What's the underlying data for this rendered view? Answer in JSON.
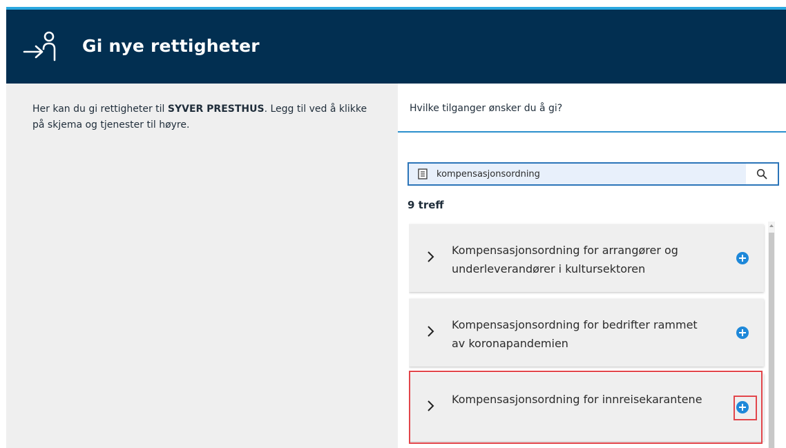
{
  "header": {
    "title": "Gi nye rettigheter",
    "icon": "person-arrow-icon"
  },
  "left": {
    "intro_before": "Her kan du gi rettigheter til ",
    "intro_name": "SYVER PRESTHUS",
    "intro_after": ". Legg til ved å klikke på skjema og tjenester til høyre."
  },
  "right": {
    "question": "Hvilke tilganger ønsker du å gi?",
    "search": {
      "value": "kompensasjonsordning",
      "icon": "document-icon",
      "button_icon": "search-icon"
    },
    "hits": "9 treff",
    "results": [
      {
        "title": "Kompensasjonsordning for arrangører og underleverandører i kultursektoren"
      },
      {
        "title": "Kompensasjonsordning for bedrifter rammet av koronapandemien"
      },
      {
        "title": "Kompensasjonsordning for innreisekarantene"
      }
    ]
  },
  "colors": {
    "header_bg": "#022f51",
    "accent_stripe": "#2aa7df",
    "add_button": "#1e88d9",
    "highlight": "#e2454a"
  }
}
